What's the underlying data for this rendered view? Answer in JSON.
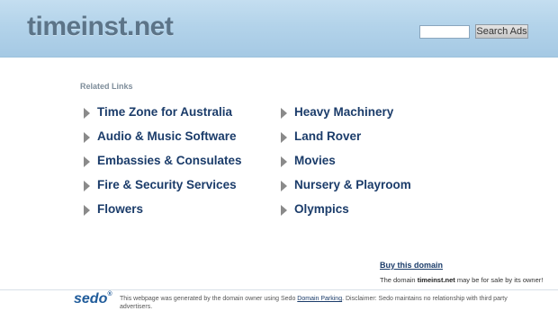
{
  "header": {
    "site_name": "timeinst.net",
    "search_value": "",
    "search_button": "Search Ads"
  },
  "related": {
    "title": "Related Links",
    "left": [
      "Time Zone for Australia",
      "Audio & Music Software",
      "Embassies & Consulates",
      "Fire & Security Services",
      "Flowers"
    ],
    "right": [
      "Heavy Machinery",
      "Land Rover",
      "Movies",
      "Nursery & Playroom",
      "Olympics"
    ]
  },
  "sale": {
    "buy_label": "Buy this domain",
    "text_prefix": "The domain ",
    "domain": "timeinst.net",
    "text_suffix": " may be for sale by its owner!"
  },
  "footer": {
    "logo": "sedo",
    "logo_mark": "®",
    "disclaimer_a": "This webpage was generated by the domain owner using Sedo ",
    "disclaimer_link": "Domain Parking",
    "disclaimer_b": ". Disclaimer: Sedo maintains no relationship with third party advertisers."
  }
}
